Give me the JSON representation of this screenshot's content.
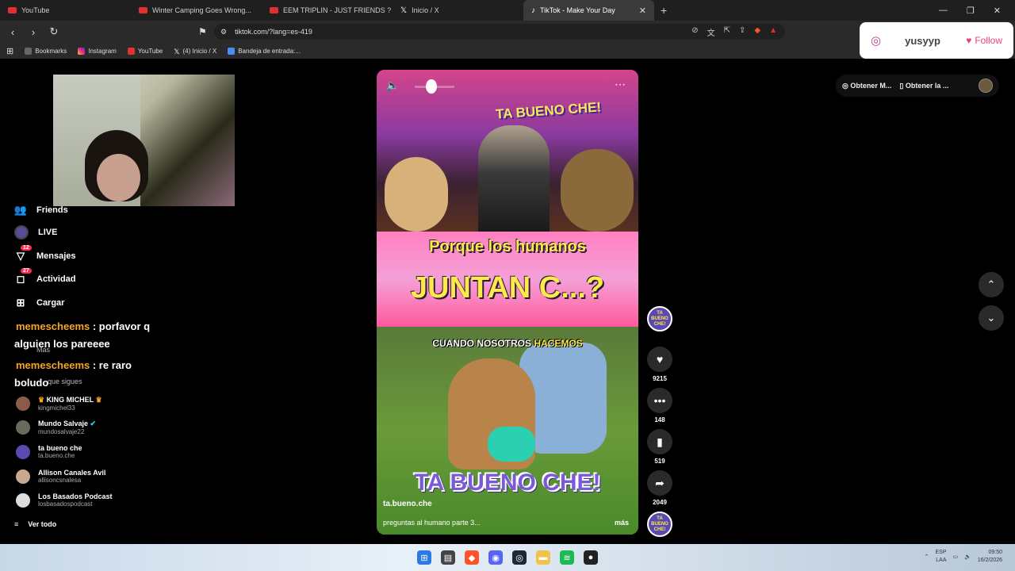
{
  "browser": {
    "tabs": [
      {
        "label": "YouTube",
        "icon": "youtube-icon"
      },
      {
        "label": "Winter Camping Goes Wrong...",
        "icon": "youtube-icon"
      },
      {
        "label": "EEM TRIPLIN - JUST FRIENDS ? (OFFI",
        "icon": "youtube-icon"
      },
      {
        "label": "Inicio / X",
        "icon": "x-icon"
      },
      {
        "label": "TikTok - Make Your Day",
        "icon": "tiktok-icon",
        "active": true
      }
    ],
    "url": "tiktok.com/?lang=es-419",
    "bookmarks": [
      {
        "label": "Bookmarks",
        "icon": "folder-icon"
      },
      {
        "label": "Instagram",
        "icon": "instagram-icon"
      },
      {
        "label": "YouTube",
        "icon": "youtube-icon"
      },
      {
        "label": "(4) Inicio / X",
        "icon": "x-icon"
      },
      {
        "label": "Bandeja de entrada:...",
        "icon": "mail-icon"
      }
    ]
  },
  "instagram_card": {
    "username": "yusyyp",
    "follow_label": "Follow"
  },
  "header": {
    "get_coins": "Obtener M...",
    "get_app": "Obtener la ..."
  },
  "sidebar": {
    "items": [
      {
        "label": "Friends",
        "icon": "friends-icon"
      },
      {
        "label": "LIVE",
        "icon": "live-icon"
      },
      {
        "label": "Mensajes",
        "icon": "messages-icon",
        "badge": "12"
      },
      {
        "label": "Actividad",
        "icon": "activity-icon",
        "badge": "27"
      },
      {
        "label": "Cargar",
        "icon": "upload-icon"
      }
    ],
    "more_label": "Más",
    "following_header": "que sigues",
    "accounts": [
      {
        "name": "KING MICHEL",
        "handle": "kingmichel33"
      },
      {
        "name": "Mundo Salvaje",
        "handle": "mundosalvaje22"
      },
      {
        "name": "ta bueno che",
        "handle": "ta.bueno.che"
      },
      {
        "name": "Allison Canales Avil",
        "handle": "allisoncsnalesa"
      },
      {
        "name": "Los Basados Podcast",
        "handle": "losbasadospodcast"
      }
    ],
    "see_all": "Ver todo"
  },
  "chat": [
    {
      "user": "memescheems",
      "line1": ": porfavor q",
      "line2": "alguien los pareeee"
    },
    {
      "user": "memescheems",
      "line1": ": re raro",
      "line2": "boludo"
    }
  ],
  "video": {
    "top_banner": "TA BUENO CHE!",
    "headline_1": "Porque los humanos",
    "headline_2": "JUNTAN C...?",
    "caption_a": "CUANDO NOSOTROS ",
    "caption_b": "HACEMOS",
    "logo": "TA BUENO CHE!",
    "handle": "ta.bueno.che",
    "description": "preguntas al humano parte 3...",
    "more_label": "más"
  },
  "actions": {
    "likes": "9215",
    "comments": "148",
    "saves": "519",
    "shares": "2049",
    "creator_label": "TA BUENO CHE!"
  },
  "taskbar": {
    "lang_1": "ESP",
    "lang_2": "LAA",
    "time": "09:50",
    "date": "16/2/2026"
  },
  "colors": {
    "tiktok_red": "#fe2c55",
    "chat_user": "#f5a623",
    "follow_pink": "#ef3e7a"
  }
}
